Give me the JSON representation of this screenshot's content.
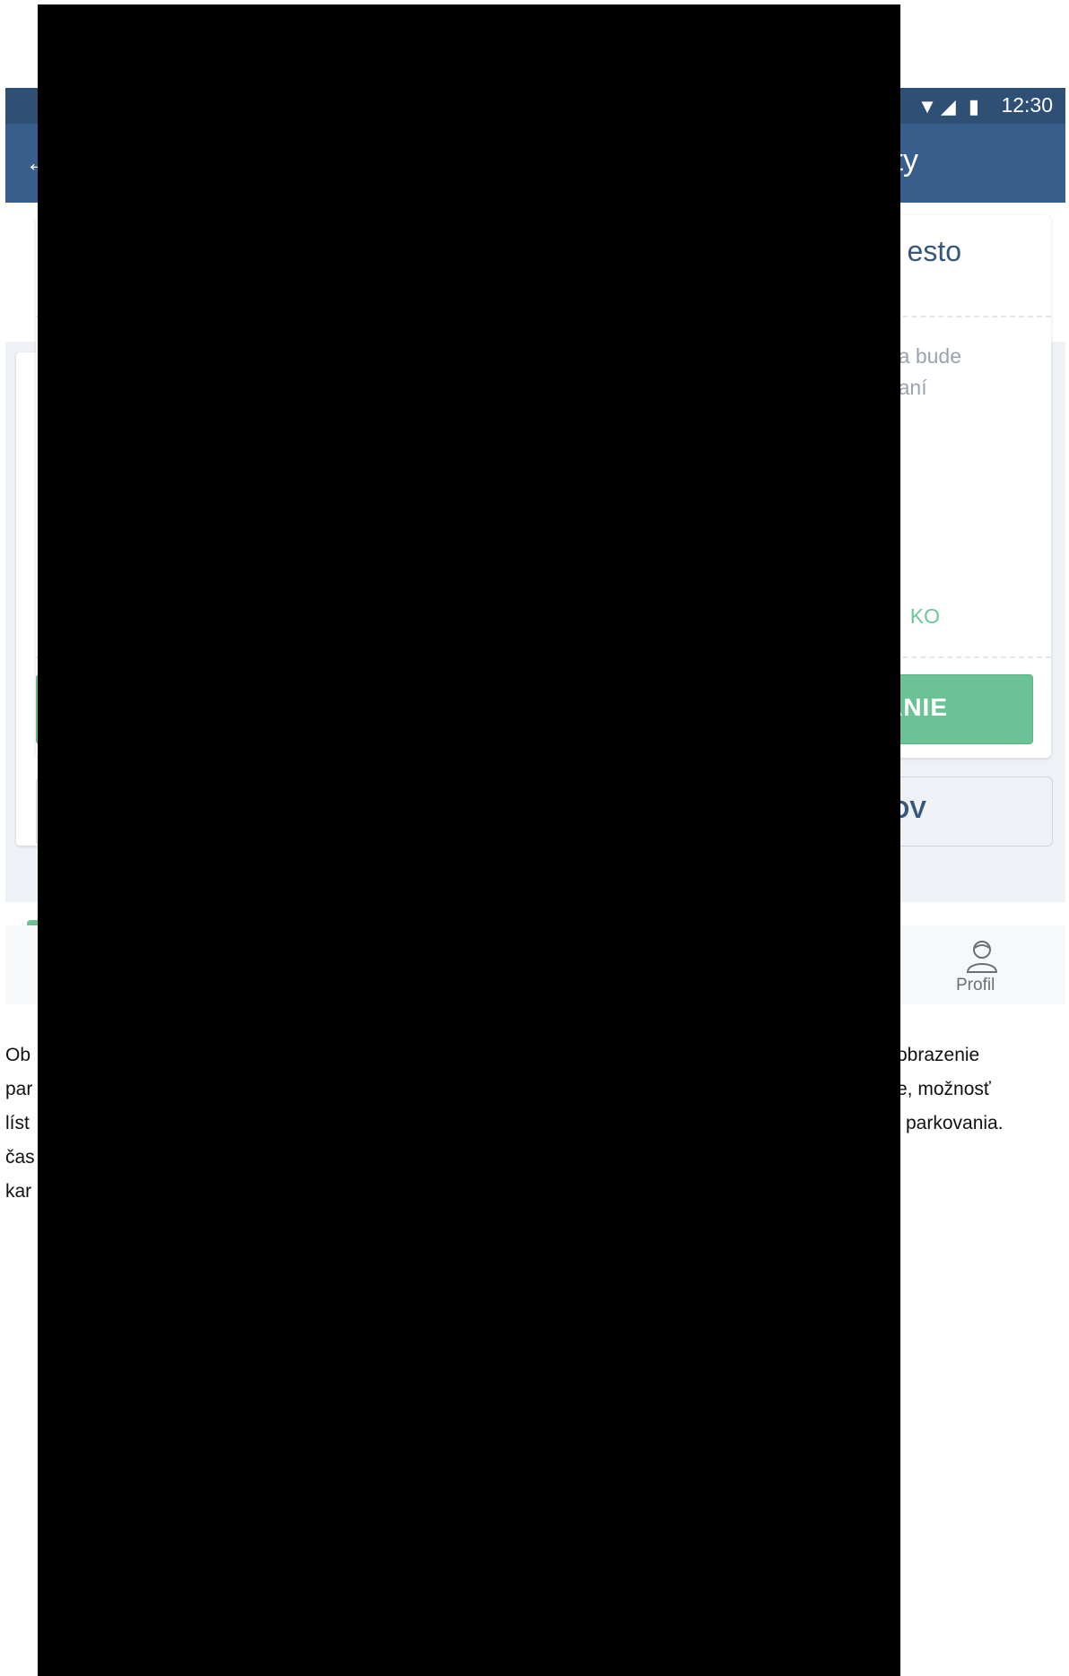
{
  "status_bar": {
    "icons": "▼◢ ▮",
    "time": "12:30"
  },
  "header": {
    "back_icon": "←",
    "title_fragment": "ty"
  },
  "card": {
    "title_fragment": "esto",
    "description": [
      "a bude",
      "aní"
    ],
    "link_fragment": "KO",
    "button_fragment": "ANIE"
  },
  "secondary_button_fragment": "OV",
  "bottom_nav": {
    "profile_label": "Profil"
  },
  "document": {
    "left_fragments": [
      "Ob",
      "par",
      "líst",
      "čas",
      "kar"
    ],
    "right_fragments": [
      "obrazenie",
      "e, možnosť",
      "parkovania."
    ]
  },
  "colors": {
    "header": "#385e8c",
    "status_bar": "#2f4f75",
    "accent_green": "#6bc395",
    "title_blue": "#36567d",
    "redaction": "#000000"
  }
}
